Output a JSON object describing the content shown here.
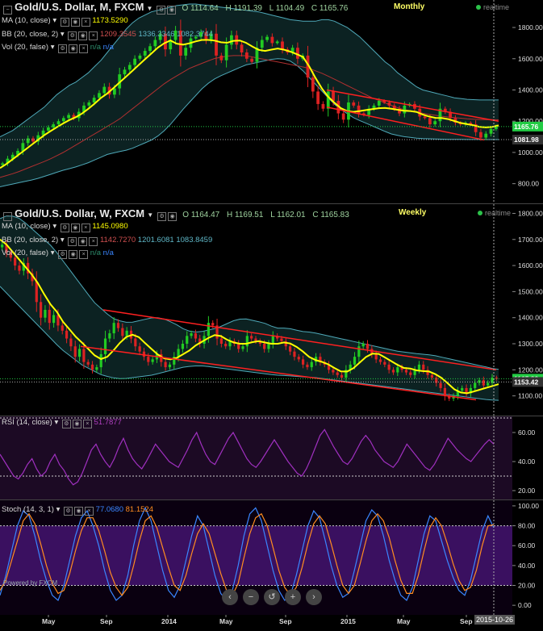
{
  "monthly": {
    "title": "Gold/U.S. Dollar, M, FXCM",
    "ohlc": {
      "o_label": "O",
      "o": "1114.64",
      "h_label": "H",
      "h": "1191.39",
      "l_label": "L",
      "l": "1104.49",
      "c_label": "C",
      "c": "1165.76"
    },
    "timeframe": "Monthly",
    "realtime": "realtime",
    "ma": {
      "label": "MA (10, close)",
      "value": "1173.5290"
    },
    "bb": {
      "label": "BB (20, close, 2)",
      "values": [
        "1209.3545",
        "1336.3346",
        "1082.3744"
      ]
    },
    "vol": {
      "label": "Vol (20, false)",
      "values": [
        "n/a",
        "n/a"
      ]
    },
    "price_tags": [
      {
        "text": "1165.76",
        "color": "#22cc44"
      },
      {
        "text": "1081.98",
        "color": "#333333"
      }
    ]
  },
  "weekly": {
    "title": "Gold/U.S. Dollar, W, FXCM",
    "ohlc": {
      "o_label": "O",
      "o": "1164.47",
      "h_label": "H",
      "h": "1169.51",
      "l_label": "L",
      "l": "1162.01",
      "c_label": "C",
      "c": "1165.83"
    },
    "timeframe": "Weekly",
    "realtime": "realtime",
    "ma": {
      "label": "MA (10, close)",
      "value": "1145.0980"
    },
    "bb": {
      "label": "BB (20, close, 2)",
      "values": [
        "1142.7270",
        "1201.6081",
        "1083.8459"
      ]
    },
    "vol": {
      "label": "Vol (20, false)",
      "values": [
        "n/a",
        "n/a"
      ]
    },
    "price_tags": [
      {
        "text": "1165.83",
        "color": "#22cc44"
      },
      {
        "text": "1153.42",
        "color": "#333333"
      }
    ]
  },
  "rsi": {
    "label": "RSI (14, close)",
    "value": "51.7877"
  },
  "stoch": {
    "label": "Stoch (14, 3, 1)",
    "values": [
      "77.0680",
      "81.1524"
    ]
  },
  "x_axis_labels": [
    "May",
    "Sep",
    "2014",
    "May",
    "Sep",
    "2015",
    "May",
    "Sep"
  ],
  "cursor_date": "2015-10-26",
  "watermark": "Powered by FXCM",
  "chart_data": [
    {
      "type": "candlestick",
      "title": "Gold/U.S. Dollar, M, FXCM",
      "yticks": [
        800,
        1000,
        1200,
        1400,
        1600,
        1800
      ],
      "ylim": [
        700,
        1950
      ],
      "closes": [
        930,
        960,
        985,
        1010,
        1060,
        1090,
        1070,
        1110,
        1140,
        1160,
        1180,
        1200,
        1220,
        1240,
        1220,
        1260,
        1300,
        1320,
        1350,
        1380,
        1420,
        1370,
        1410,
        1500,
        1530,
        1560,
        1600,
        1620,
        1650,
        1680,
        1720,
        1760,
        1660,
        1720,
        1780,
        1620,
        1670,
        1730,
        1740,
        1770,
        1720,
        1760,
        1620,
        1590,
        1690,
        1750,
        1690,
        1640,
        1600,
        1580,
        1670,
        1720,
        1740,
        1700,
        1710,
        1660,
        1640,
        1670,
        1600,
        1620,
        1480,
        1390,
        1310,
        1280,
        1390,
        1330,
        1250,
        1210,
        1320,
        1300,
        1250,
        1240,
        1280,
        1300,
        1330,
        1320,
        1300,
        1280,
        1250,
        1300,
        1310,
        1280,
        1230,
        1220,
        1180,
        1200,
        1280,
        1260,
        1220,
        1190,
        1180,
        1190,
        1180,
        1130,
        1095,
        1120,
        1150,
        1166
      ],
      "ma10": [
        900,
        920,
        945,
        970,
        995,
        1020,
        1045,
        1070,
        1095,
        1120,
        1140,
        1160,
        1180,
        1200,
        1215,
        1230,
        1250,
        1275,
        1300,
        1330,
        1360,
        1380,
        1410,
        1440,
        1470,
        1500,
        1530,
        1560,
        1590,
        1620,
        1650,
        1680,
        1700,
        1720,
        1700,
        1690,
        1690,
        1700,
        1710,
        1720,
        1720,
        1720,
        1715,
        1705,
        1700,
        1710,
        1720,
        1715,
        1700,
        1680,
        1660,
        1650,
        1650,
        1660,
        1665,
        1660,
        1650,
        1640,
        1625,
        1610,
        1560,
        1500,
        1440,
        1390,
        1350,
        1320,
        1290,
        1270,
        1260,
        1260,
        1265,
        1270,
        1275,
        1280,
        1285,
        1285,
        1280,
        1275,
        1270,
        1265,
        1265,
        1260,
        1245,
        1235,
        1225,
        1220,
        1220,
        1215,
        1205,
        1195,
        1185,
        1180,
        1175,
        1165,
        1160,
        1160,
        1165,
        1173
      ],
      "bb_upper": [
        1100,
        1120,
        1140,
        1170,
        1200,
        1230,
        1260,
        1290,
        1330,
        1370,
        1400,
        1430,
        1450,
        1480,
        1510,
        1550,
        1590,
        1640,
        1690,
        1740,
        1790,
        1830,
        1860,
        1880,
        1900,
        1910,
        1920,
        1930,
        1940,
        1945,
        1950,
        1950,
        1945,
        1940,
        1935,
        1930,
        1925,
        1920,
        1915,
        1910,
        1905,
        1900,
        1890,
        1880,
        1870,
        1860,
        1850,
        1845,
        1840,
        1840,
        1840,
        1850,
        1850,
        1840,
        1820,
        1800,
        1770,
        1740,
        1700,
        1660,
        1620,
        1580,
        1550,
        1510,
        1480,
        1450,
        1420,
        1400,
        1390,
        1380,
        1370,
        1360,
        1350,
        1345,
        1340,
        1338,
        1336,
        1336,
        1336,
        1336
      ],
      "bb_lower": [
        780,
        790,
        800,
        810,
        820,
        830,
        845,
        860,
        875,
        890,
        900,
        915,
        930,
        950,
        970,
        990,
        1000,
        1010,
        1020,
        1040,
        1060,
        1080,
        1110,
        1150,
        1200,
        1260,
        1310,
        1360,
        1410,
        1450,
        1480,
        1500,
        1520,
        1540,
        1560,
        1570,
        1580,
        1590,
        1600,
        1600,
        1590,
        1560,
        1520,
        1470,
        1420,
        1370,
        1320,
        1280,
        1250,
        1220,
        1200,
        1180,
        1160,
        1140,
        1120,
        1110,
        1100,
        1095,
        1090,
        1088,
        1086,
        1085,
        1084,
        1084,
        1083,
        1083,
        1083,
        1082,
        1082,
        1082
      ],
      "bb_mid": [
        840,
        855,
        870,
        890,
        910,
        930,
        950,
        975,
        1000,
        1030,
        1060,
        1090,
        1120,
        1150,
        1180,
        1210,
        1250,
        1290,
        1330,
        1370,
        1410,
        1450,
        1480,
        1510,
        1540,
        1560,
        1580,
        1600,
        1610,
        1620,
        1620,
        1620,
        1610,
        1600,
        1590,
        1580,
        1570,
        1560,
        1550,
        1540,
        1520,
        1500,
        1475,
        1450,
        1425,
        1400,
        1375,
        1350,
        1330,
        1310,
        1290,
        1275,
        1265,
        1255,
        1245,
        1238,
        1230,
        1225,
        1220,
        1215,
        1212,
        1210,
        1210,
        1209
      ],
      "channel_upper": [
        [
          1400,
          1200
        ]
      ],
      "channel_lower": [
        [
          1290,
          1080
        ]
      ]
    },
    {
      "type": "candlestick",
      "title": "Gold/U.S. Dollar, W, FXCM",
      "yticks": [
        1100,
        1200,
        1300,
        1400,
        1500,
        1600,
        1700,
        1800
      ],
      "ylim": [
        1040,
        1820
      ],
      "closes": [
        1680,
        1650,
        1630,
        1600,
        1580,
        1610,
        1570,
        1540,
        1460,
        1400,
        1430,
        1380,
        1410,
        1370,
        1350,
        1320,
        1290,
        1250,
        1280,
        1230,
        1220,
        1200,
        1210,
        1260,
        1320,
        1340,
        1380,
        1360,
        1330,
        1350,
        1320,
        1290,
        1270,
        1250,
        1230,
        1240,
        1260,
        1230,
        1210,
        1220,
        1250,
        1280,
        1300,
        1330,
        1340,
        1320,
        1300,
        1330,
        1380,
        1370,
        1320,
        1300,
        1290,
        1310,
        1300,
        1280,
        1290,
        1330,
        1320,
        1310,
        1300,
        1280,
        1300,
        1330,
        1320,
        1310,
        1290,
        1270,
        1250,
        1240,
        1220,
        1210,
        1230,
        1250,
        1230,
        1220,
        1200,
        1190,
        1180,
        1170,
        1200,
        1220,
        1250,
        1290,
        1300,
        1280,
        1260,
        1240,
        1230,
        1220,
        1200,
        1190,
        1210,
        1200,
        1190,
        1180,
        1200,
        1220,
        1200,
        1180,
        1170,
        1150,
        1130,
        1100,
        1090,
        1100,
        1120,
        1130,
        1110,
        1130,
        1150,
        1160,
        1140,
        1150,
        1170,
        1166
      ],
      "ma10": [
        1700,
        1690,
        1670,
        1650,
        1630,
        1610,
        1590,
        1570,
        1550,
        1520,
        1490,
        1460,
        1440,
        1420,
        1390,
        1370,
        1350,
        1330,
        1310,
        1300,
        1280,
        1260,
        1250,
        1240,
        1245,
        1260,
        1280,
        1300,
        1320,
        1330,
        1335,
        1330,
        1320,
        1300,
        1285,
        1270,
        1255,
        1245,
        1240,
        1240,
        1245,
        1255,
        1265,
        1275,
        1290,
        1300,
        1310,
        1320,
        1330,
        1335,
        1330,
        1320,
        1310,
        1305,
        1300,
        1300,
        1300,
        1305,
        1310,
        1310,
        1305,
        1300,
        1300,
        1300,
        1305,
        1305,
        1300,
        1290,
        1280,
        1265,
        1250,
        1240,
        1235,
        1230,
        1225,
        1215,
        1205,
        1195,
        1190,
        1195,
        1205,
        1220,
        1235,
        1250,
        1260,
        1265,
        1260,
        1250,
        1240,
        1230,
        1220,
        1210,
        1205,
        1205,
        1200,
        1195,
        1195,
        1195,
        1190,
        1180,
        1170,
        1155,
        1140,
        1125,
        1115,
        1110,
        1110,
        1115,
        1120,
        1125,
        1130,
        1135,
        1140,
        1145
      ],
      "bb_upper": [
        1780,
        1790,
        1790,
        1785,
        1770,
        1750,
        1730,
        1710,
        1690,
        1670,
        1640,
        1610,
        1580,
        1550,
        1520,
        1490,
        1460,
        1440,
        1420,
        1400,
        1390,
        1385,
        1380,
        1385,
        1390,
        1395,
        1400,
        1400,
        1395,
        1385,
        1375,
        1360,
        1350,
        1345,
        1345,
        1350,
        1355,
        1360,
        1370,
        1380,
        1390,
        1395,
        1395,
        1390,
        1385,
        1380,
        1370,
        1360,
        1360,
        1360,
        1355,
        1350,
        1345,
        1345,
        1340,
        1335,
        1330,
        1325,
        1320,
        1315,
        1310,
        1305,
        1300,
        1295,
        1290,
        1285,
        1280,
        1275,
        1270,
        1268,
        1265,
        1262,
        1260,
        1258,
        1255,
        1250,
        1245,
        1240,
        1235,
        1230,
        1225,
        1220,
        1215,
        1210,
        1205,
        1202
      ],
      "bb_lower": [
        1520,
        1480,
        1440,
        1400,
        1360,
        1320,
        1280,
        1250,
        1220,
        1200,
        1180,
        1170,
        1165,
        1170,
        1175,
        1180,
        1190,
        1200,
        1210,
        1215,
        1215,
        1210,
        1205,
        1200,
        1195,
        1190,
        1185,
        1180,
        1178,
        1175,
        1172,
        1170,
        1165,
        1160,
        1155,
        1150,
        1145,
        1140,
        1135,
        1130,
        1125,
        1120,
        1115,
        1110,
        1105,
        1100,
        1095,
        1090,
        1085,
        1083
      ],
      "channel_upper": [
        [
          1430,
          1200
        ]
      ],
      "channel_lower": [
        [
          1290,
          1085
        ]
      ]
    },
    {
      "type": "line",
      "title": "RSI (14, close)",
      "yticks": [
        20,
        40,
        60
      ],
      "ylim": [
        15,
        70
      ],
      "levels": [
        30,
        70
      ],
      "values": [
        45,
        40,
        35,
        30,
        28,
        32,
        38,
        42,
        35,
        30,
        33,
        40,
        45,
        38,
        34,
        28,
        24,
        26,
        32,
        40,
        48,
        52,
        45,
        40,
        36,
        42,
        50,
        56,
        48,
        42,
        38,
        35,
        40,
        46,
        52,
        48,
        44,
        40,
        38,
        36,
        42,
        48,
        55,
        60,
        52,
        45,
        40,
        38,
        44,
        50,
        56,
        60,
        54,
        48,
        42,
        38,
        36,
        40,
        45,
        50,
        55,
        50,
        45,
        40,
        36,
        32,
        30,
        35,
        42,
        50,
        58,
        62,
        56,
        50,
        45,
        40,
        38,
        42,
        48,
        54,
        58,
        54,
        48,
        44,
        40,
        38,
        36,
        40,
        46,
        52,
        48,
        44,
        40,
        36,
        34,
        38,
        44,
        50,
        56,
        52,
        48,
        45,
        42,
        40,
        44,
        48,
        52,
        55,
        52
      ],
      "last": 51.7877
    },
    {
      "type": "line",
      "title": "Stoch (14, 3, 1)",
      "yticks": [
        0,
        20,
        40,
        60,
        80,
        100
      ],
      "ylim": [
        -8,
        104
      ],
      "levels": [
        20,
        80
      ],
      "series": [
        {
          "values": [
            10,
            30,
            55,
            80,
            95,
            90,
            70,
            45,
            25,
            10,
            5,
            20,
            45,
            70,
            88,
            95,
            80,
            60,
            35,
            15,
            5,
            10,
            30,
            60,
            85,
            98,
            85,
            60,
            35,
            15,
            8,
            20,
            45,
            70,
            90,
            80,
            55,
            30,
            12,
            5,
            15,
            40,
            70,
            92,
            98,
            85,
            60,
            35,
            15,
            5,
            10,
            30,
            55,
            80,
            95,
            88,
            65,
            40,
            20,
            8,
            12,
            35,
            60,
            85,
            96,
            90,
            70,
            45,
            25,
            10,
            5,
            18,
            45,
            72,
            90,
            85,
            65,
            45,
            28,
            15,
            10,
            25,
            50,
            75,
            90,
            78
          ]
        },
        {
          "values": [
            15,
            25,
            45,
            65,
            85,
            92,
            82,
            62,
            40,
            22,
            12,
            15,
            32,
            55,
            75,
            88,
            88,
            75,
            55,
            33,
            18,
            10,
            18,
            40,
            65,
            85,
            90,
            78,
            58,
            38,
            20,
            15,
            30,
            52,
            72,
            82,
            72,
            52,
            32,
            15,
            10,
            22,
            48,
            72,
            88,
            92,
            80,
            58,
            35,
            18,
            10,
            18,
            38,
            62,
            82,
            90,
            82,
            62,
            40,
            20,
            12,
            20,
            42,
            65,
            85,
            92,
            85,
            68,
            45,
            25,
            12,
            12,
            30,
            55,
            78,
            88,
            80,
            62,
            42,
            25,
            15,
            18,
            35,
            60,
            80,
            81
          ]
        }
      ],
      "last": [
        77.068,
        81.1524
      ]
    }
  ]
}
